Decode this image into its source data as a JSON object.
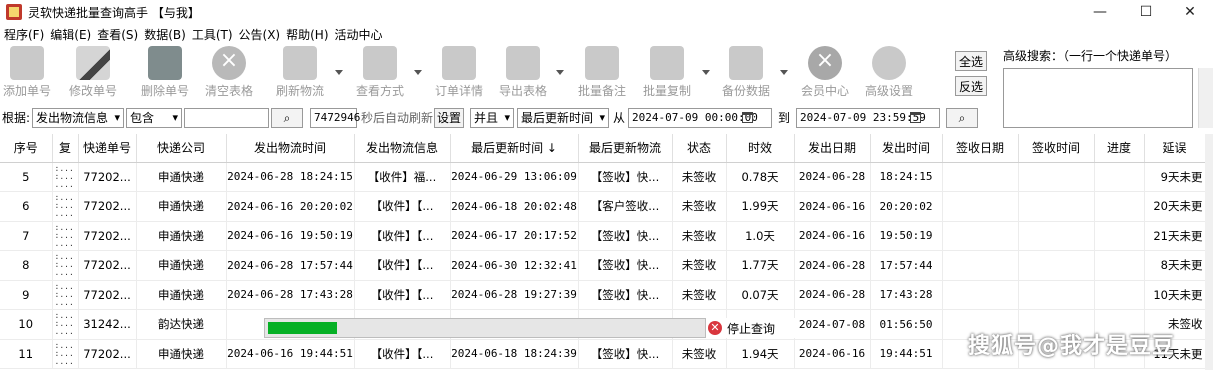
{
  "window": {
    "title": "灵软快递批量查询高手 【与我】",
    "minimize_glyph": "—",
    "maximize_glyph": "☐",
    "close_glyph": "✕"
  },
  "menu": [
    "程序(F)",
    "编辑(E)",
    "查看(S)",
    "数据(B)",
    "工具(T)",
    "公告(X)",
    "帮助(H)",
    "活动中心"
  ],
  "toolbar": {
    "add": "添加单号",
    "edit": "修改单号",
    "delete": "删除单号",
    "clear": "清空表格",
    "refresh": "刷新物流",
    "view_mode": "查看方式",
    "order_detail": "订单详情",
    "export": "导出表格",
    "batch_note": "批量备注",
    "batch_copy": "批量复制",
    "backup": "备份数据",
    "member": "会员中心",
    "settings": "高级设置"
  },
  "side": {
    "select_all": "全选",
    "invert": "反选",
    "advanced_search_label": "高级搜索：（一行一个快递单号）"
  },
  "filter": {
    "by_label": "根据:",
    "field": "发出物流信息",
    "match": "包含",
    "keyword": "",
    "interval": "7472946",
    "auto_refresh_label": "秒后自动刷新",
    "set_button": "设置",
    "logic": "并且",
    "time_field": "最后更新时间",
    "from_label": "从",
    "from": "2024-07-09 00:00:00",
    "to_label": "到",
    "to": "2024-07-09 23:59:59"
  },
  "columns": [
    "序号",
    "复",
    "快递单号",
    "快递公司",
    "发出物流时间",
    "发出物流信息",
    "最后更新时间 ↓",
    "最后更新物流",
    "状态",
    "时效",
    "发出日期",
    "发出时间",
    "签收日期",
    "签收时间",
    "进度",
    "延误"
  ],
  "rows": [
    {
      "no": "5",
      "dots": ":...\n:...\n....",
      "tracking": "77202...",
      "company": "申通快递",
      "sent_time": "2024-06-28 18:24:15",
      "sent_info": "【收件】福...",
      "last_update": "2024-06-29 13:06:09",
      "last_info": "【签收】快...",
      "status": "未签收",
      "duration": "0.78天",
      "send_date": "2024-06-28",
      "send_time": "18:24:15",
      "sign_date": "",
      "sign_time": "",
      "progress": "",
      "delay": "9天未更"
    },
    {
      "no": "6",
      "dots": ":...\n:...\n....",
      "tracking": "77202...",
      "company": "申通快递",
      "sent_time": "2024-06-16 20:20:02",
      "sent_info": "【收件】【...",
      "last_update": "2024-06-18 20:02:48",
      "last_info": "【客户签收...",
      "status": "未签收",
      "duration": "1.99天",
      "send_date": "2024-06-16",
      "send_time": "20:20:02",
      "sign_date": "",
      "sign_time": "",
      "progress": "",
      "delay": "20天未更"
    },
    {
      "no": "7",
      "dots": ":...\n:...\n....",
      "tracking": "77202...",
      "company": "申通快递",
      "sent_time": "2024-06-16 19:50:19",
      "sent_info": "【收件】【...",
      "last_update": "2024-06-17 20:17:52",
      "last_info": "【签收】快...",
      "status": "未签收",
      "duration": "1.0天",
      "send_date": "2024-06-16",
      "send_time": "19:50:19",
      "sign_date": "",
      "sign_time": "",
      "progress": "",
      "delay": "21天未更"
    },
    {
      "no": "8",
      "dots": ":...\n:...\n....",
      "tracking": "77202...",
      "company": "申通快递",
      "sent_time": "2024-06-28 17:57:44",
      "sent_info": "【收件】【...",
      "last_update": "2024-06-30 12:32:41",
      "last_info": "【签收】快...",
      "status": "未签收",
      "duration": "1.77天",
      "send_date": "2024-06-28",
      "send_time": "17:57:44",
      "sign_date": "",
      "sign_time": "",
      "progress": "",
      "delay": "8天未更"
    },
    {
      "no": "9",
      "dots": ":...\n:...\n....",
      "tracking": "77202...",
      "company": "申通快递",
      "sent_time": "2024-06-28 17:43:28",
      "sent_info": "【收件】【...",
      "last_update": "2024-06-28 19:27:39",
      "last_info": "【签收】快...",
      "status": "未签收",
      "duration": "0.07天",
      "send_date": "2024-06-28",
      "send_time": "17:43:28",
      "sign_date": "",
      "sign_time": "",
      "progress": "",
      "delay": "10天未更"
    },
    {
      "no": "10",
      "dots": ":...\n:...\n....",
      "tracking": "31242...",
      "company": "韵达快递",
      "sent_time": "2024-",
      "sent_info": "",
      "last_update": "",
      "last_info": "",
      "status": "",
      "duration": "",
      "send_date": "2024-07-08",
      "send_time": "01:56:50",
      "sign_date": "",
      "sign_time": "",
      "progress": "",
      "delay": "未签收"
    },
    {
      "no": "11",
      "dots": ":...\n:...\n....",
      "tracking": "77202...",
      "company": "申通快递",
      "sent_time": "2024-06-16 19:44:51",
      "sent_info": "【收件】【...",
      "last_update": "2024-06-18 18:24:39",
      "last_info": "【签收】快...",
      "status": "未签收",
      "duration": "1.94天",
      "send_date": "2024-06-16",
      "send_time": "19:44:51",
      "sign_date": "",
      "sign_time": "",
      "progress": "",
      "delay": "11天未更"
    }
  ],
  "progress": {
    "value": 0.16,
    "stop_label": "停止查询"
  },
  "watermark": "搜狐号@我才是豆豆",
  "colors": {
    "progress_fill": "#06b025",
    "stop_icon": "#d9363e"
  }
}
